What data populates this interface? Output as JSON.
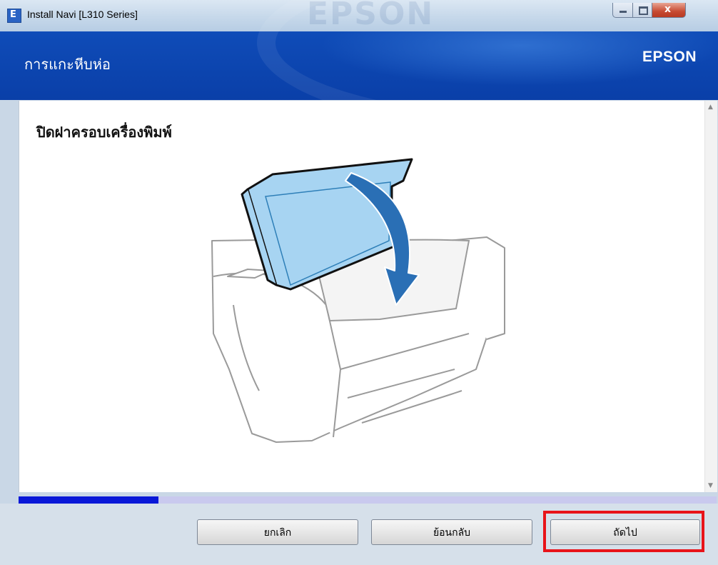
{
  "window": {
    "title": "Install Navi [L310 Series]",
    "close_glyph": "x"
  },
  "header": {
    "step_title": "การแกะหีบห่อ",
    "logo": "EPSON"
  },
  "content": {
    "instruction": "ปิดฝาครอบเครื่องพิมพ์",
    "illustration": "printer-cover-closing-icon"
  },
  "progress": {
    "fraction": 0.2
  },
  "buttons": {
    "cancel": "ยกเลิก",
    "back": "ย้อนกลับ",
    "next": "ถัดไป"
  },
  "colors": {
    "header_blue": "#0a3fa8",
    "progress_blue": "#0a18d8",
    "highlight_red": "#e8141a"
  }
}
